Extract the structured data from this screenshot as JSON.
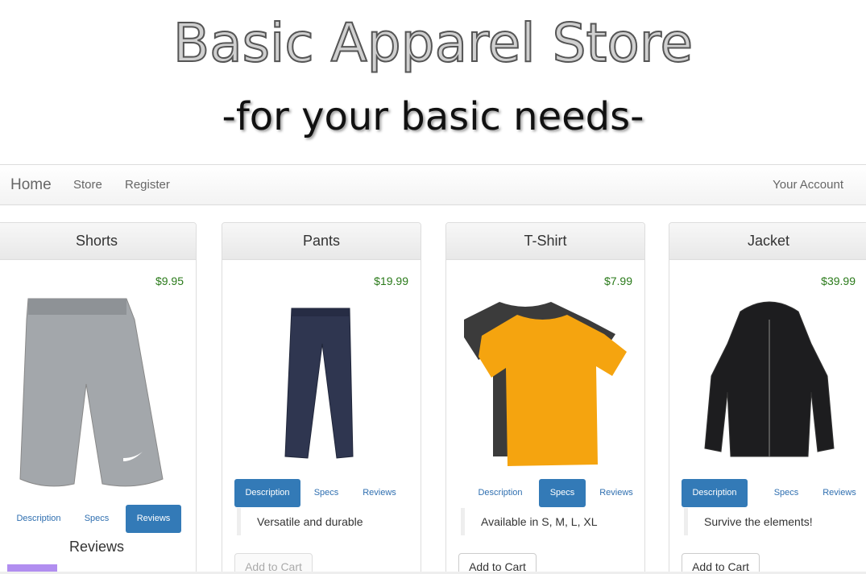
{
  "hero": {
    "title": "Basic Apparel Store",
    "subtitle": "-for your basic needs-"
  },
  "nav": {
    "home": "Home",
    "store": "Store",
    "register": "Register",
    "account": "Your Account"
  },
  "tabs": {
    "description": "Description",
    "specs": "Specs",
    "reviews": "Reviews"
  },
  "add_to_cart": "Add to Cart",
  "products": [
    {
      "name": "Shorts",
      "price": "$9.95",
      "active_tab": "Reviews",
      "reviews_heading": "Reviews"
    },
    {
      "name": "Pants",
      "price": "$19.99",
      "active_tab": "Description",
      "text": "Versatile and durable"
    },
    {
      "name": "T-Shirt",
      "price": "$7.99",
      "active_tab": "Specs",
      "text": "Available in S, M, L, XL"
    },
    {
      "name": "Jacket",
      "price": "$39.99",
      "active_tab": "Description",
      "text": "Survive the elements!"
    }
  ],
  "colors": {
    "price": "#2a7a1a",
    "active_tab": "#337ab7",
    "link": "#2f6fb0"
  }
}
